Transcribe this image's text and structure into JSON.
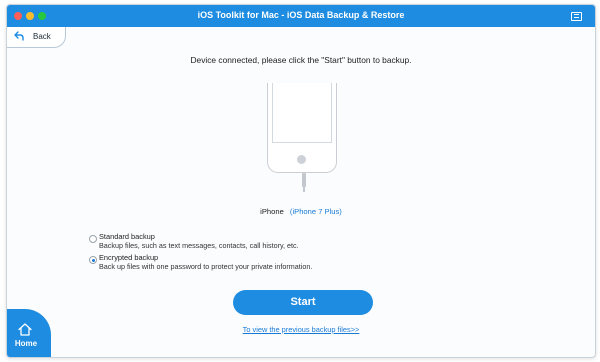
{
  "window": {
    "title": "iOS Toolkit for Mac - iOS Data Backup & Restore"
  },
  "nav": {
    "back_label": "Back",
    "home_label": "Home"
  },
  "main": {
    "instruction": "Device connected, please click the \"Start\" button to backup.",
    "device_name": "iPhone",
    "device_model": "(iPhone 7 Plus)"
  },
  "options": [
    {
      "title": "Standard backup",
      "description": "Backup files, such as text messages, contacts, call history, etc.",
      "selected": false
    },
    {
      "title": "Encrypted backup",
      "description": "Back up files with one password to protect your private information.",
      "selected": true
    }
  ],
  "actions": {
    "start_label": "Start",
    "previous_link": "To view the previous backup files>>"
  },
  "colors": {
    "accent": "#1e8ce1",
    "link": "#1a7bd6"
  },
  "icons": [
    "feedback-icon",
    "back-arrow-icon",
    "home-icon"
  ]
}
